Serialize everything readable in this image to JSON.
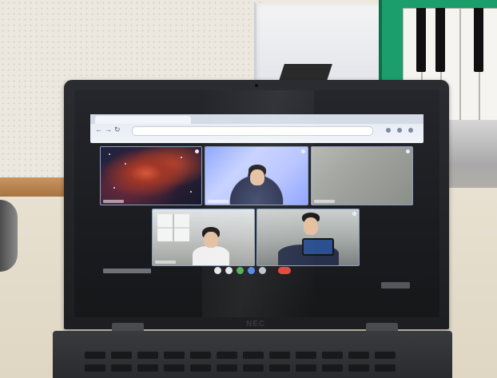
{
  "photo": {
    "laptop_brand": "NEC"
  },
  "meeting": {
    "participants": [
      {
        "tile": "nebula-wallpaper"
      },
      {
        "tile": "student-blue-background"
      },
      {
        "tile": "gray-video"
      },
      {
        "tile": "student-room"
      },
      {
        "tile": "student-holding-phone"
      }
    ],
    "controls": [
      "mic",
      "camera",
      "captions",
      "raise-hand",
      "more-options",
      "leave-call"
    ]
  },
  "colors": {
    "leave_call": "#e3453b",
    "keyboard_box": "#1b9e6c",
    "tile_border": "#8a9fbf"
  }
}
